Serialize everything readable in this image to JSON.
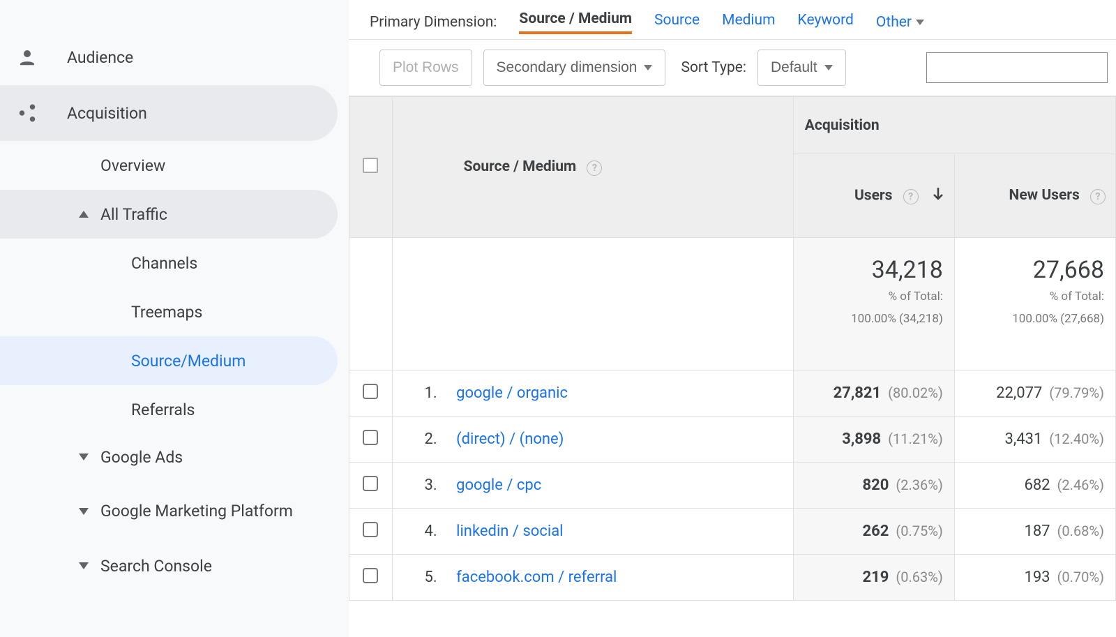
{
  "sidebar": {
    "audience": {
      "label": "Audience"
    },
    "acquisition": {
      "label": "Acquisition",
      "overview": "Overview",
      "all_traffic": {
        "label": "All Traffic",
        "channels": "Channels",
        "treemaps": "Treemaps",
        "source_medium": "Source/Medium",
        "referrals": "Referrals"
      },
      "google_ads": "Google Ads",
      "gmp": "Google Marketing Platform",
      "search_console": "Search Console"
    }
  },
  "dimensions": {
    "lead": "Primary Dimension:",
    "tabs": [
      "Source / Medium",
      "Source",
      "Medium",
      "Keyword"
    ],
    "other": "Other"
  },
  "toolbar": {
    "plot_rows": "Plot Rows",
    "secondary": "Secondary dimension",
    "sort_lead": "Sort Type:",
    "sort_default": "Default"
  },
  "table": {
    "dim_header": "Source / Medium",
    "section_header": "Acquisition",
    "cols": {
      "users": "Users",
      "new_users": "New Users"
    },
    "totals": {
      "users": "34,218",
      "users_sub1": "% of Total:",
      "users_sub2": "100.00% (34,218)",
      "new_users": "27,668",
      "new_users_sub1": "% of Total:",
      "new_users_sub2": "100.00% (27,668)"
    },
    "rows": [
      {
        "i": "1.",
        "src": "google / organic",
        "u": "27,821",
        "up": "(80.02%)",
        "n": "22,077",
        "np": "(79.79%)"
      },
      {
        "i": "2.",
        "src": "(direct) / (none)",
        "u": "3,898",
        "up": "(11.21%)",
        "n": "3,431",
        "np": "(12.40%)"
      },
      {
        "i": "3.",
        "src": "google / cpc",
        "u": "820",
        "up": "(2.36%)",
        "n": "682",
        "np": "(2.46%)"
      },
      {
        "i": "4.",
        "src": "linkedin / social",
        "u": "262",
        "up": "(0.75%)",
        "n": "187",
        "np": "(0.68%)"
      },
      {
        "i": "5.",
        "src": "facebook.com / referral",
        "u": "219",
        "up": "(0.63%)",
        "n": "193",
        "np": "(0.70%)"
      }
    ]
  }
}
